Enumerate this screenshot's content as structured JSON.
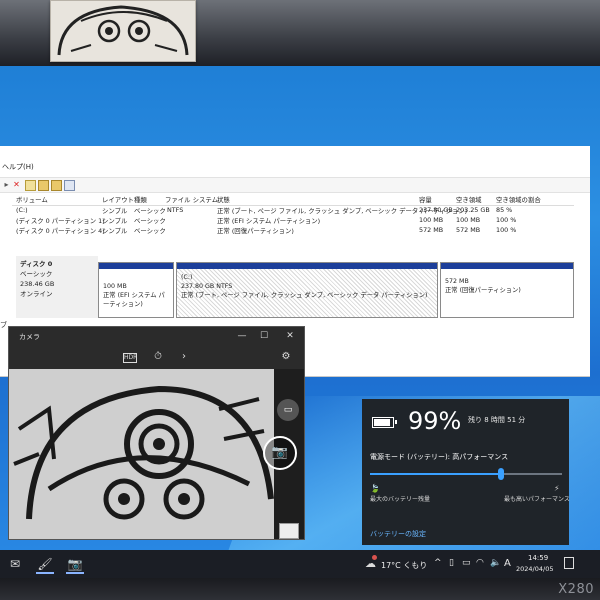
{
  "model_badge": "X280",
  "disk_mgmt": {
    "menu_partial": "ヘルプ(H)",
    "columns": [
      "ボリューム",
      "レイアウト",
      "種類",
      "ファイル システム",
      "状態",
      "容量",
      "空き領域",
      "空き領域の割合"
    ],
    "rows": [
      {
        "volume": "(C:)",
        "layout": "シンプル",
        "type": "ベーシック",
        "fs": "NTFS",
        "status": "正常 (ブート, ページ ファイル, クラッシュ ダンプ, ベーシック データ パーティション)",
        "capacity": "237.80 GB",
        "free": "203.25 GB",
        "pct": "85 %"
      },
      {
        "volume": "(ディスク 0 パーティション 1)",
        "layout": "シンプル",
        "type": "ベーシック",
        "fs": "",
        "status": "正常 (EFI システム パーティション)",
        "capacity": "100 MB",
        "free": "100 MB",
        "pct": "100 %"
      },
      {
        "volume": "(ディスク 0 パーティション 4)",
        "layout": "シンプル",
        "type": "ベーシック",
        "fs": "",
        "status": "正常 (回復パーティション)",
        "capacity": "572 MB",
        "free": "572 MB",
        "pct": "100 %"
      }
    ],
    "disk": {
      "name": "ディスク 0",
      "kind": "ベーシック",
      "size": "238.46 GB",
      "state": "オンライン"
    },
    "partitions": [
      {
        "title": "",
        "size": "100 MB",
        "status": "正常 (EFI システム パーティション)"
      },
      {
        "title": "(C:)",
        "size": "237.80 GB NTFS",
        "status": "正常 (ブート, ページ ファイル, クラッシュ ダンプ, ベーシック データ パーティション)"
      },
      {
        "title": "",
        "size": "572 MB",
        "status": "正常 (回復パーティション)"
      }
    ],
    "left_marker": "ブ"
  },
  "camera": {
    "title": "カメラ",
    "minimize": "—",
    "maximize": "☐",
    "close": "✕",
    "toolbar_icons": [
      "hdr-icon",
      "timer-icon",
      "chevron-right-icon",
      "settings-icon"
    ],
    "hdr_label": "HDR"
  },
  "battery": {
    "percent": "99%",
    "level": 0.99,
    "remaining": "残り 8 時間 51 分",
    "mode_label": "電源モード (バッテリー): 高パフォーマンス",
    "slider_level": 0.68,
    "left_caption": "最大のバッテリー残量",
    "right_caption": "最も高いパフォーマンス",
    "settings_link": "バッテリーの設定"
  },
  "taskbar": {
    "apps": [
      "mail-icon",
      "paint-icon",
      "camera-icon"
    ],
    "weather": "17°C くもり",
    "ime": "A",
    "time": "14:59",
    "date": "2024/04/05"
  }
}
